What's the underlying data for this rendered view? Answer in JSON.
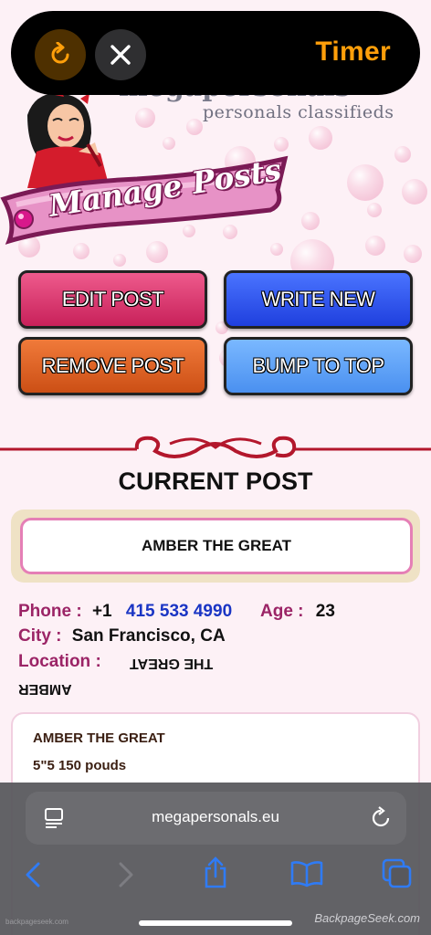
{
  "timer": {
    "refresh_icon": "refresh-icon",
    "close_icon": "close-icon",
    "label": "Timer",
    "accent": "#ff9f0a"
  },
  "header": {
    "brand_tagline": "personals classifieds",
    "banner_title": "Manage Posts"
  },
  "actions": {
    "edit": "EDIT POST",
    "write": "WRITE NEW",
    "remove": "REMOVE POST",
    "bump": "BUMP TO TOP"
  },
  "post": {
    "section_title": "CURRENT POST",
    "title": "AMBER THE GREAT",
    "phone_label": "Phone :",
    "phone_prefix": "+1",
    "phone_number": "415 533 4990",
    "age_label": "Age :",
    "age_value": "23",
    "city_label": "City :",
    "city_value": "San Francisco, CA",
    "location_label": "Location :",
    "location_value_1": "THE GREAT",
    "location_value_2": "AMBER",
    "description_title": "AMBER THE GREAT",
    "description_line": "5\"5 150 pouds"
  },
  "browser": {
    "url": "megapersonals.eu",
    "tabs_icon": "page-menu-icon",
    "reload_icon": "reload-icon",
    "toolbar_icons": [
      "back-icon",
      "forward-icon",
      "share-icon",
      "bookmarks-icon",
      "tabs-icon"
    ]
  },
  "watermark": {
    "left": "backpageseek.com",
    "right": "BackpageSeek.com"
  },
  "colors": {
    "label": "#9b2466",
    "phone": "#1a35c4",
    "edit_button": "#d8336c",
    "write_button": "#2d50ee",
    "remove_button": "#dc5f22",
    "bump_button": "#5fa3f7",
    "divider": "#b3172c"
  }
}
